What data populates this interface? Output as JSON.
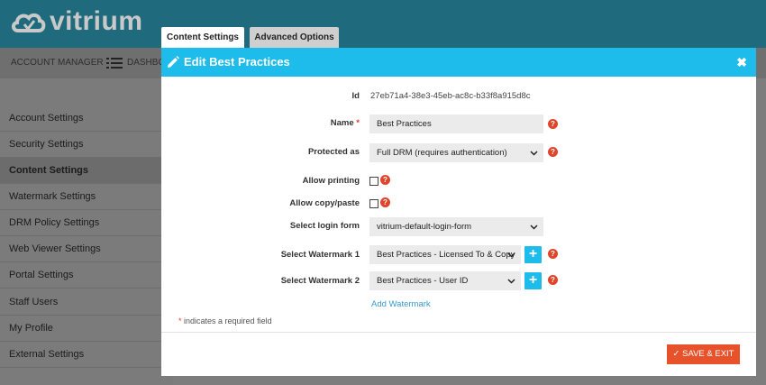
{
  "app": {
    "logo_text": "vitrium"
  },
  "nav": {
    "account_manager": "ACCOUNT MANAGER",
    "dashboard": "DASHBO"
  },
  "sidebar": {
    "items": [
      {
        "label": "Account Settings"
      },
      {
        "label": "Security Settings"
      },
      {
        "label": "Content Settings"
      },
      {
        "label": "Watermark Settings"
      },
      {
        "label": "DRM Policy Settings"
      },
      {
        "label": "Web Viewer Settings"
      },
      {
        "label": "Portal Settings"
      },
      {
        "label": "Staff Users"
      },
      {
        "label": "My Profile"
      },
      {
        "label": "External Settings"
      }
    ]
  },
  "tabs": {
    "content_settings": "Content Settings",
    "advanced_options": "Advanced Options"
  },
  "modal": {
    "title": "Edit Best Practices",
    "close_glyph": "✖",
    "id_label": "Id",
    "id_value": "27eb71a4-38e3-45eb-ac8c-b33f8a915d8c",
    "name_label": "Name",
    "name_required_mark": "*",
    "name_value": "Best Practices",
    "protected_label": "Protected as",
    "protected_value": "Full DRM (requires authentication)",
    "printing_label": "Allow printing",
    "printing_checked": false,
    "copy_label": "Allow copy/paste",
    "copy_checked": false,
    "login_form_label": "Select login form",
    "login_form_value": "vitrium-default-login-form",
    "watermark1_label": "Select Watermark 1",
    "watermark1_value": "Best Practices - Licensed To & Copy",
    "watermark2_label": "Select Watermark 2",
    "watermark2_value": "Best Practices - User ID",
    "add_watermark": "Add Watermark",
    "help_glyph": "?",
    "plus_glyph": "+",
    "required_note_mark": "*",
    "required_note": " indicates a required field",
    "save_label": "SAVE & EXIT",
    "save_check": "✓"
  },
  "colors": {
    "accent": "#1ebcea",
    "save": "#e8522b",
    "help": "#e0442a"
  }
}
